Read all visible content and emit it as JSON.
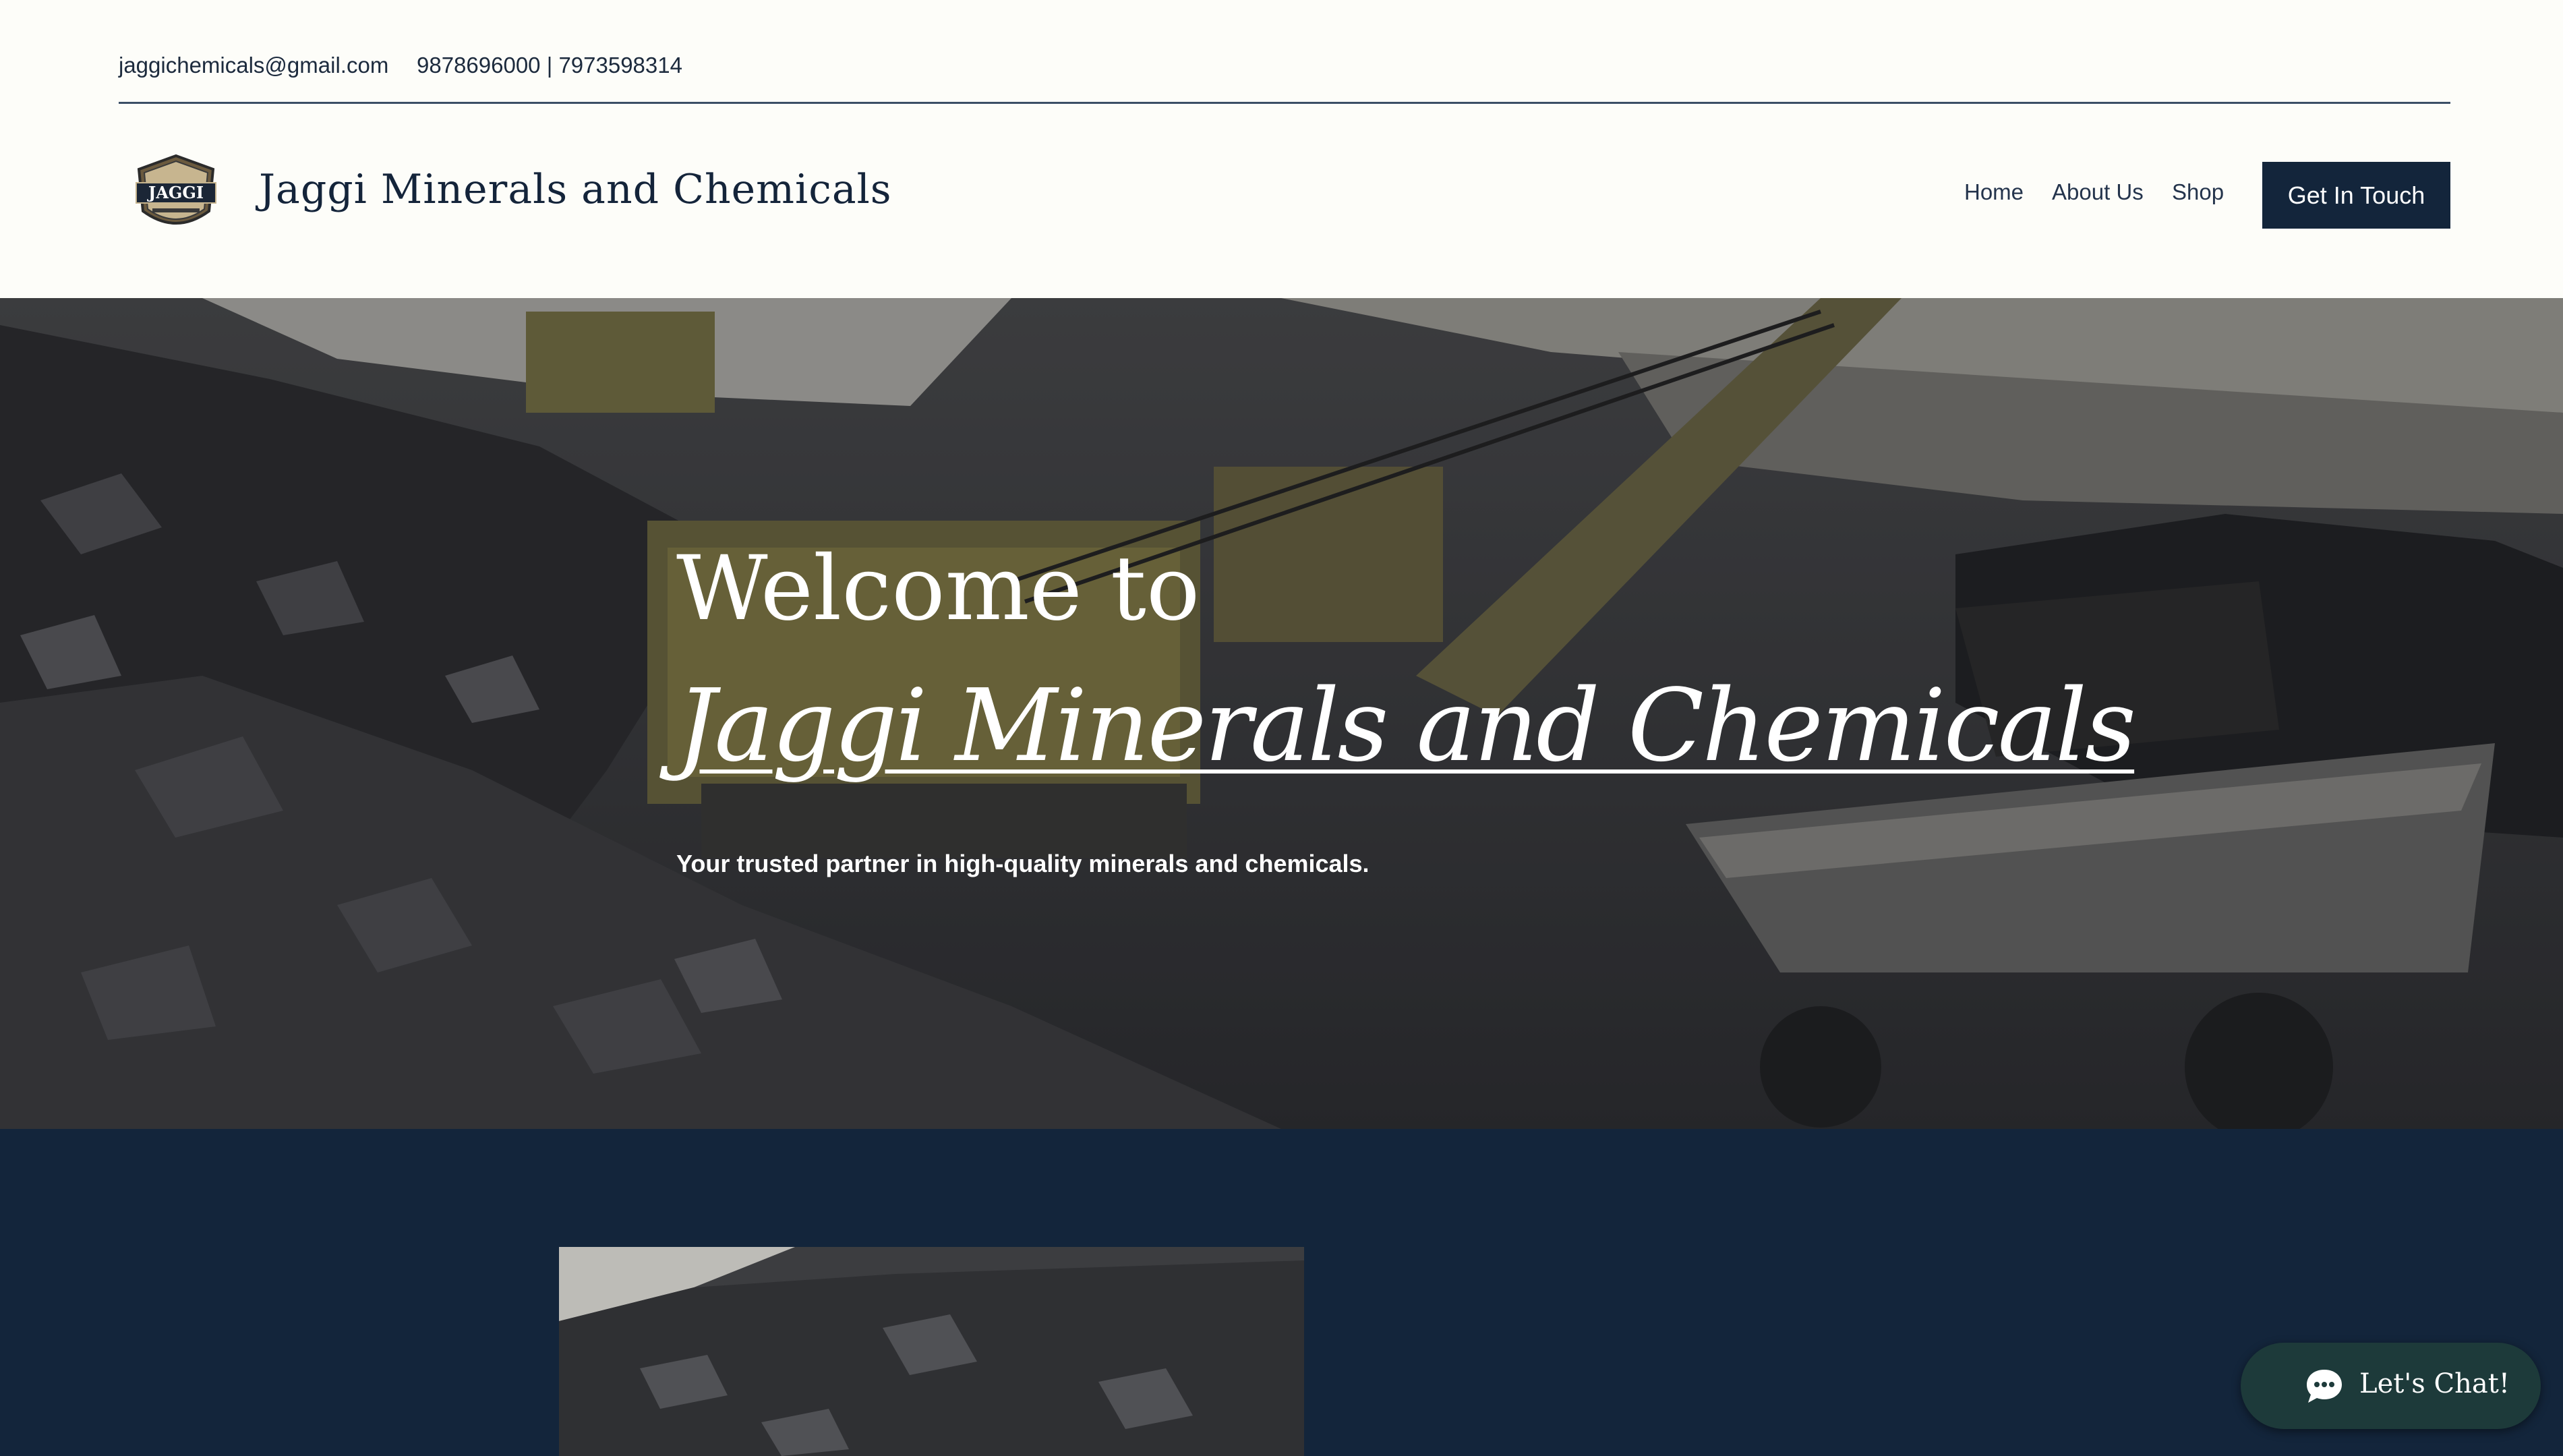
{
  "topbar": {
    "email": "jaggichemicals@gmail.com",
    "phone": "9878696000 | 7973598314"
  },
  "header": {
    "logo_text": "JAGGI",
    "brand_name": "Jaggi Minerals and Chemicals",
    "nav": {
      "home": "Home",
      "about": "About Us",
      "shop": "Shop"
    },
    "cta_label": "Get In Touch"
  },
  "hero": {
    "welcome": "Welcome to",
    "title": "Jaggi Minerals and Chemicals",
    "subtitle": "Your trusted partner in high-quality minerals and chemicals."
  },
  "chat": {
    "label": "Let's Chat!",
    "icon": "chat-bubble-icon"
  },
  "colors": {
    "navy": "#13253b",
    "page_bg": "#fdfdf9",
    "chat_bg": "#1d3a3a",
    "text_dark": "#14243a"
  }
}
